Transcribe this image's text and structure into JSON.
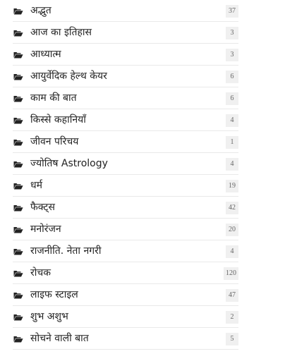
{
  "categories": {
    "items": [
      {
        "label": "अद्भुत",
        "count": "37"
      },
      {
        "label": "आज का इतिहास",
        "count": "3"
      },
      {
        "label": "आध्यात्म",
        "count": "3"
      },
      {
        "label": "आयुर्वेदिक हेल्थ केयर",
        "count": "6"
      },
      {
        "label": "काम की बात",
        "count": "6"
      },
      {
        "label": "किस्से कहानियाँ",
        "count": "4"
      },
      {
        "label": "जीवन परिचय",
        "count": "1"
      },
      {
        "label": "ज्योतिष Astrology",
        "count": "4"
      },
      {
        "label": "धर्म",
        "count": "19"
      },
      {
        "label": "फैक्ट्स",
        "count": "42"
      },
      {
        "label": "मनोरंजन",
        "count": "20"
      },
      {
        "label": "राजनीति. नेता नगरी",
        "count": "4"
      },
      {
        "label": "रोचक",
        "count": "120"
      },
      {
        "label": "लाइफ स्टाइल",
        "count": "47"
      },
      {
        "label": "शुभ अशुभ",
        "count": "2"
      },
      {
        "label": "सोचने वाली बात",
        "count": "5"
      }
    ],
    "icon": "folder-open-icon",
    "icon_color": "#222222",
    "badge_bg": "#f0f0f0"
  }
}
